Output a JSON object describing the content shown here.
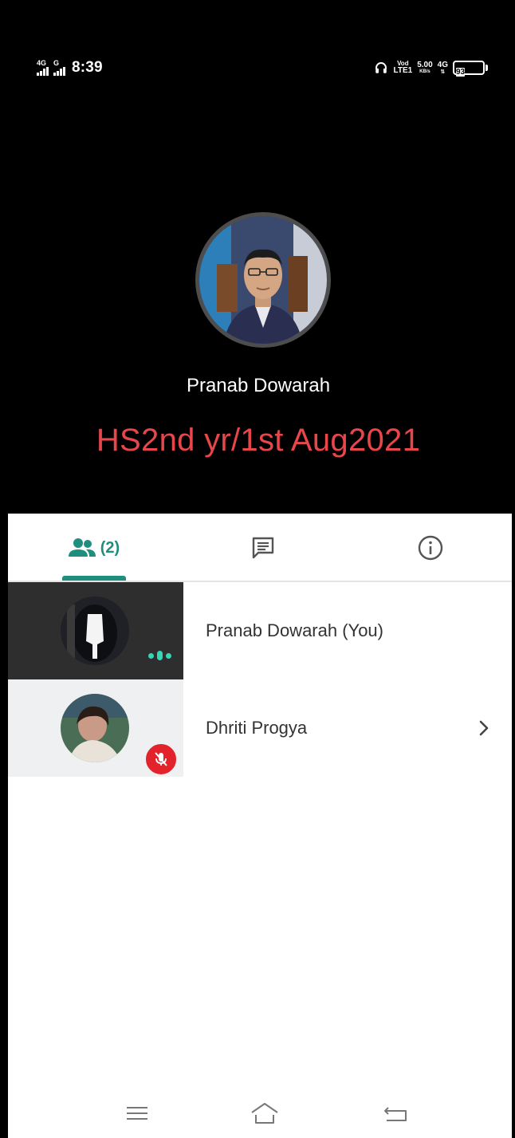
{
  "status_bar": {
    "sim1_net": "4G",
    "sim2_net": "G",
    "time": "8:39",
    "volte_top": "Vod",
    "volte_bottom": "LTE1",
    "speed_value": "5.00",
    "speed_unit": "KB/s",
    "data_net": "4G",
    "battery_level": "93"
  },
  "call": {
    "host_name": "Pranab Dowarah",
    "meeting_title": "HS2nd yr/1st Aug2021",
    "title_color": "#e8464b"
  },
  "tabs": {
    "people_icon": "people-icon",
    "people_count": "(2)",
    "chat_icon": "chat-icon",
    "info_icon": "info-icon",
    "accent_color": "#1e8e7e"
  },
  "participants": [
    {
      "name": "Pranab Dowarah (You)",
      "status": "speaking"
    },
    {
      "name": "Dhriti Progya",
      "status": "muted"
    }
  ],
  "nav": {
    "menu_icon": "menu-icon",
    "home_icon": "home-icon",
    "back_icon": "back-icon"
  }
}
